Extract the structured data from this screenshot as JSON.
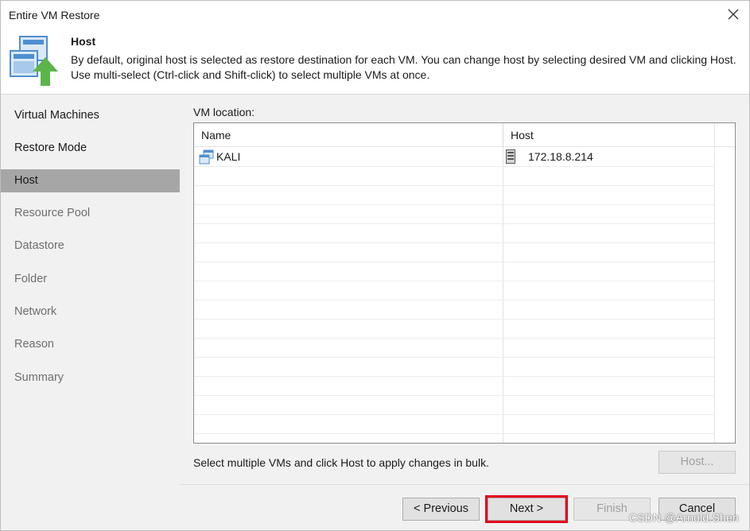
{
  "window": {
    "title": "Entire VM Restore"
  },
  "header": {
    "title": "Host",
    "description": "By default, original host is selected as restore destination for each VM. You can change host by selecting desired VM and clicking Host. Use multi-select (Ctrl-click and Shift-click) to select multiple VMs at once."
  },
  "sidebar": {
    "items": [
      {
        "label": "Virtual Machines",
        "state": "done"
      },
      {
        "label": "Restore Mode",
        "state": "done"
      },
      {
        "label": "Host",
        "state": "active"
      },
      {
        "label": "Resource Pool",
        "state": "pending"
      },
      {
        "label": "Datastore",
        "state": "pending"
      },
      {
        "label": "Folder",
        "state": "pending"
      },
      {
        "label": "Network",
        "state": "pending"
      },
      {
        "label": "Reason",
        "state": "pending"
      },
      {
        "label": "Summary",
        "state": "pending"
      }
    ]
  },
  "main": {
    "vm_location_label": "VM location:",
    "columns": {
      "name": "Name",
      "host": "Host"
    },
    "rows": [
      {
        "name": "KALI",
        "host": "172.18.8.214",
        "name_icon": "vm-icon",
        "host_icon": "server-icon"
      }
    ],
    "hint": "Select multiple VMs and click Host to apply changes in bulk.",
    "host_button": "Host..."
  },
  "footer": {
    "previous": "< Previous",
    "next": "Next >",
    "finish": "Finish",
    "cancel": "Cancel"
  },
  "watermark": "CSDN @Arnold.Shen",
  "colors": {
    "sidebar_bg": "#f1f1f1",
    "active_item_bg": "#a6a6a6",
    "highlight_border": "#e3001b",
    "icon_green": "#5cb54a",
    "icon_blue": "#4f8fd0"
  }
}
